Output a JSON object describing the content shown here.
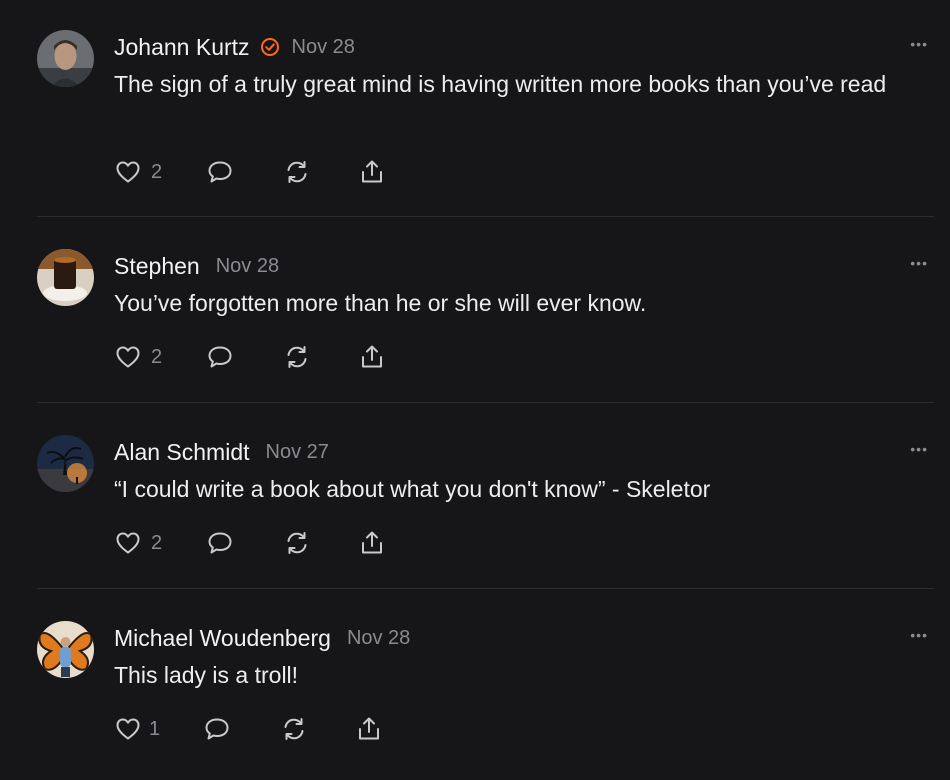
{
  "posts": [
    {
      "author": "Johann Kurtz",
      "verified": true,
      "date": "Nov 28",
      "text": "The sign of a truly great mind is having written more books than you’ve read",
      "likes": "2",
      "avatar": "portrait-avatar"
    },
    {
      "author": "Stephen",
      "verified": false,
      "date": "Nov 28",
      "text": "You’ve forgotten more than he or she will ever know.",
      "likes": "2",
      "avatar": "coffee-avatar"
    },
    {
      "author": "Alan Schmidt",
      "verified": false,
      "date": "Nov 27",
      "text": "“I could write a book about what you don't know” - Skeletor",
      "likes": "2",
      "avatar": "tree-avatar"
    },
    {
      "author": "Michael Woudenberg",
      "verified": false,
      "date": "Nov 28",
      "text": "This lady is a troll!",
      "likes": "1",
      "avatar": "butterfly-avatar"
    }
  ],
  "more_label": "•••",
  "colors": {
    "background": "#161618",
    "verified": "#ff6719",
    "muted": "#8a8a90"
  }
}
